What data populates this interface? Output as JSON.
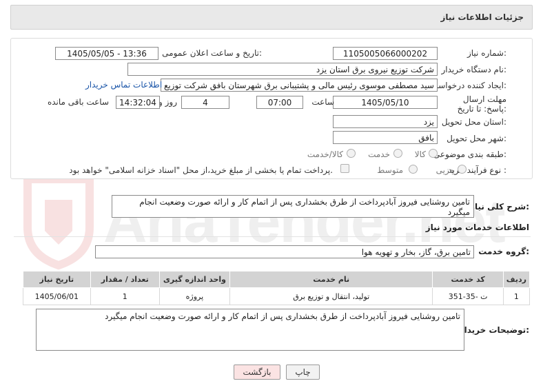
{
  "header": {
    "title": "جزئیات اطلاعات نیاز"
  },
  "form": {
    "need_number_label": "شماره نیاز:",
    "need_number": "1105005066000202",
    "announce_label": "تاریخ و ساعت اعلان عمومی:",
    "announce_value": "1405/05/05 - 13:36",
    "buyer_org_label": "نام دستگاه خریدار:",
    "buyer_org": "شرکت توزیع نیروی برق استان یزد",
    "creator_label": "ایجاد کننده درخواست:",
    "creator": "سید مصطفی  موسوی  رئیس مالی و پشتیبانی برق شهرستان بافق شرکت توزیع",
    "contact_link": "اطلاعات تماس خریدار",
    "deadline_label": "مهلت ارسال پاسخ: تا تاریخ:",
    "deadline_date": "1405/05/10",
    "time_label": "ساعت",
    "deadline_time": "07:00",
    "days_value": "4",
    "days_label": "روز و",
    "remaining_time": "14:32:04",
    "remaining_label": "ساعت باقی مانده",
    "province_label": "استان محل تحویل:",
    "province": "یزد",
    "city_label": "شهر محل تحویل:",
    "city": "بافق",
    "category_label": "طبقه بندی موضوعی:",
    "category_options": [
      "کالا",
      "خدمت",
      "کالا/خدمت"
    ],
    "purchase_label": "نوع فرآیند خرید :",
    "purchase_options": [
      "جزیی",
      "متوسط"
    ],
    "purchase_note": "پرداخت تمام یا بخشی از مبلغ خرید،از محل \"اسناد خزانه اسلامی\" خواهد بود."
  },
  "summary": {
    "label": "شرح کلی نیاز:",
    "text": "تامین روشنایی فیروز آبادپرداخت از طرق بخشداری پس از اتمام کار و ارائه صورت وضعیت انجام میگیرد"
  },
  "services": {
    "section_title": "اطلاعات خدمات مورد نیاز",
    "group_label": "گروه خدمت:",
    "group_value": "تامین برق، گاز، بخار و تهویه هوا",
    "columns": [
      "ردیف",
      "کد خدمت",
      "نام خدمت",
      "واحد اندازه گیری",
      "تعداد / مقدار",
      "تاریخ نیاز"
    ],
    "rows": [
      [
        "1",
        "ت -35-351",
        "تولید، انتقال و توزیع برق",
        "پروژه",
        "1",
        "1405/06/01"
      ]
    ]
  },
  "buyer_notes": {
    "label": "توضیحات خریدار:",
    "text": "تامین روشنایی فیروز آبادپرداخت از طرق بخشداری پس از اتمام کار و ارائه صورت وضعیت انجام میگیرد"
  },
  "buttons": {
    "print": "چاپ",
    "back": "بازگشت"
  },
  "watermark": {
    "text": "AriaTender.net"
  },
  "colors": {
    "link": "#1a55a8",
    "back_button": "#fbe3e3",
    "print_button": "#f2f2f2"
  }
}
